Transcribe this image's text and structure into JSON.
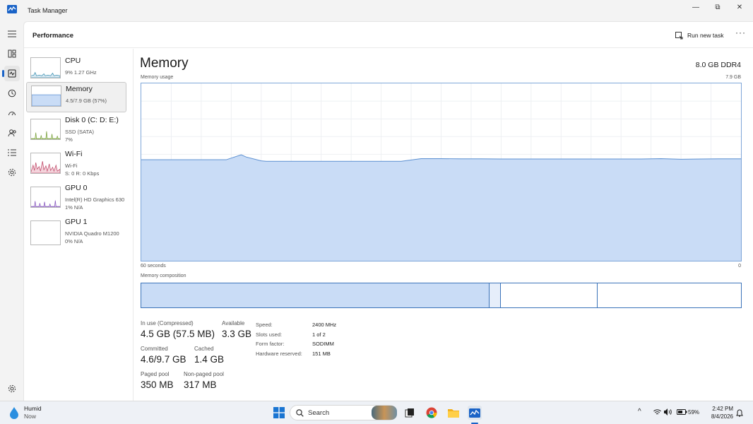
{
  "window": {
    "title": "Task Manager",
    "minimize": "—",
    "restore": "⧉",
    "close": "✕"
  },
  "header": {
    "title": "Performance",
    "run_new_task": "Run new task",
    "more": "···"
  },
  "resources": [
    {
      "name": "CPU",
      "sub1": "9%  1.27 GHz",
      "sub2": ""
    },
    {
      "name": "Memory",
      "sub1": "4.5/7.9 GB (57%)",
      "sub2": ""
    },
    {
      "name": "Disk 0 (C: D: E:)",
      "sub1": "SSD (SATA)",
      "sub2": "7%"
    },
    {
      "name": "Wi-Fi",
      "sub1": "Wi-Fi",
      "sub2": "S: 0  R: 0 Kbps"
    },
    {
      "name": "GPU 0",
      "sub1": "Intel(R) HD Graphics 630",
      "sub2": "1%  N/A"
    },
    {
      "name": "GPU 1",
      "sub1": "NVIDIA Quadro M1200",
      "sub2": "0%  N/A"
    }
  ],
  "detail": {
    "title": "Memory",
    "spec": "8.0 GB DDR4",
    "usage_label": "Memory usage",
    "usage_max": "7.9 GB",
    "time_label": "60 seconds",
    "time_end": "0",
    "composition_label": "Memory composition"
  },
  "chart_data": {
    "type": "area",
    "title": "Memory usage",
    "xlabel": "60 seconds",
    "ylabel": "",
    "xlim": [
      60,
      0
    ],
    "ylim": [
      0,
      7.9
    ],
    "x": [
      60,
      51.5,
      50,
      49.5,
      48,
      47.5,
      46,
      45,
      44,
      43,
      42,
      41,
      40,
      38,
      36,
      34,
      32,
      30,
      28,
      26,
      24,
      22,
      20,
      18,
      16,
      14,
      12,
      10,
      8,
      6,
      4,
      2,
      0
    ],
    "series": [
      {
        "values": [
          4.5,
          4.5,
          4.72,
          4.62,
          4.45,
          4.43,
          4.43,
          4.43,
          4.43,
          4.43,
          4.43,
          4.43,
          4.43,
          4.43,
          4.43,
          4.43,
          4.55,
          4.55,
          4.54,
          4.54,
          4.53,
          4.53,
          4.53,
          4.53,
          4.53,
          4.53,
          4.53,
          4.53,
          4.55,
          4.52,
          4.53,
          4.54,
          4.54
        ]
      }
    ],
    "composition": [
      {
        "part": "In use",
        "fraction": 0.581
      },
      {
        "part": "Modified",
        "fraction": 0.018
      },
      {
        "part": "Standby",
        "fraction": 0.162
      },
      {
        "part": "Free",
        "fraction": 0.239
      }
    ]
  },
  "stats": {
    "in_use_label": "In use (Compressed)",
    "in_use_value": "4.5 GB (57.5 MB)",
    "available_label": "Available",
    "available_value": "3.3 GB",
    "committed_label": "Committed",
    "committed_value": "4.6/9.7 GB",
    "cached_label": "Cached",
    "cached_value": "1.4 GB",
    "paged_label": "Paged pool",
    "paged_value": "350 MB",
    "nonpaged_label": "Non-paged pool",
    "nonpaged_value": "317 MB"
  },
  "specs": [
    {
      "key": "Speed:",
      "value": "2400 MHz"
    },
    {
      "key": "Slots used:",
      "value": "1 of 2"
    },
    {
      "key": "Form factor:",
      "value": "SODIMM"
    },
    {
      "key": "Hardware reserved:",
      "value": "151 MB"
    }
  ],
  "taskbar": {
    "weather_title": "Humid",
    "weather_sub": "Now",
    "search_label": "Search",
    "battery": "59%",
    "time": "2:42 PM",
    "date": "8/4/2026"
  },
  "colors": {
    "accent": "#1a63c7",
    "memory_fill": "#c9dcf6",
    "memory_line": "#5b8fd1"
  }
}
